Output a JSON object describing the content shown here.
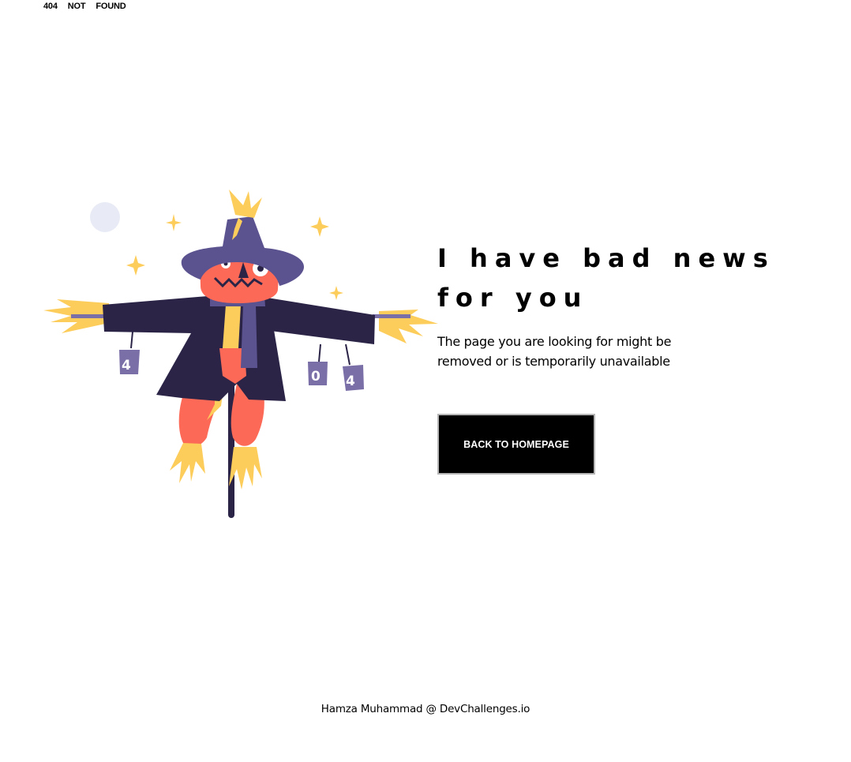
{
  "header": {
    "brand_parts": [
      "404",
      "NOT",
      "FOUND"
    ]
  },
  "illustration": {
    "name": "scarecrow",
    "can_labels": [
      "4",
      "0",
      "4"
    ],
    "colors": {
      "coat": "#2b2447",
      "hat": "#5b5290",
      "face": "#fc6a57",
      "straw": "#fdcd5b",
      "can": "#7b6fa8",
      "moon": "#e8ebf5"
    }
  },
  "content": {
    "headline": "I have bad news for you",
    "message": "The page you are looking for might be removed or is temporarily unavailable",
    "cta_label": "BACK TO HOMEPAGE"
  },
  "footer": {
    "credit": "Hamza Muhammad @ DevChallenges.io"
  }
}
